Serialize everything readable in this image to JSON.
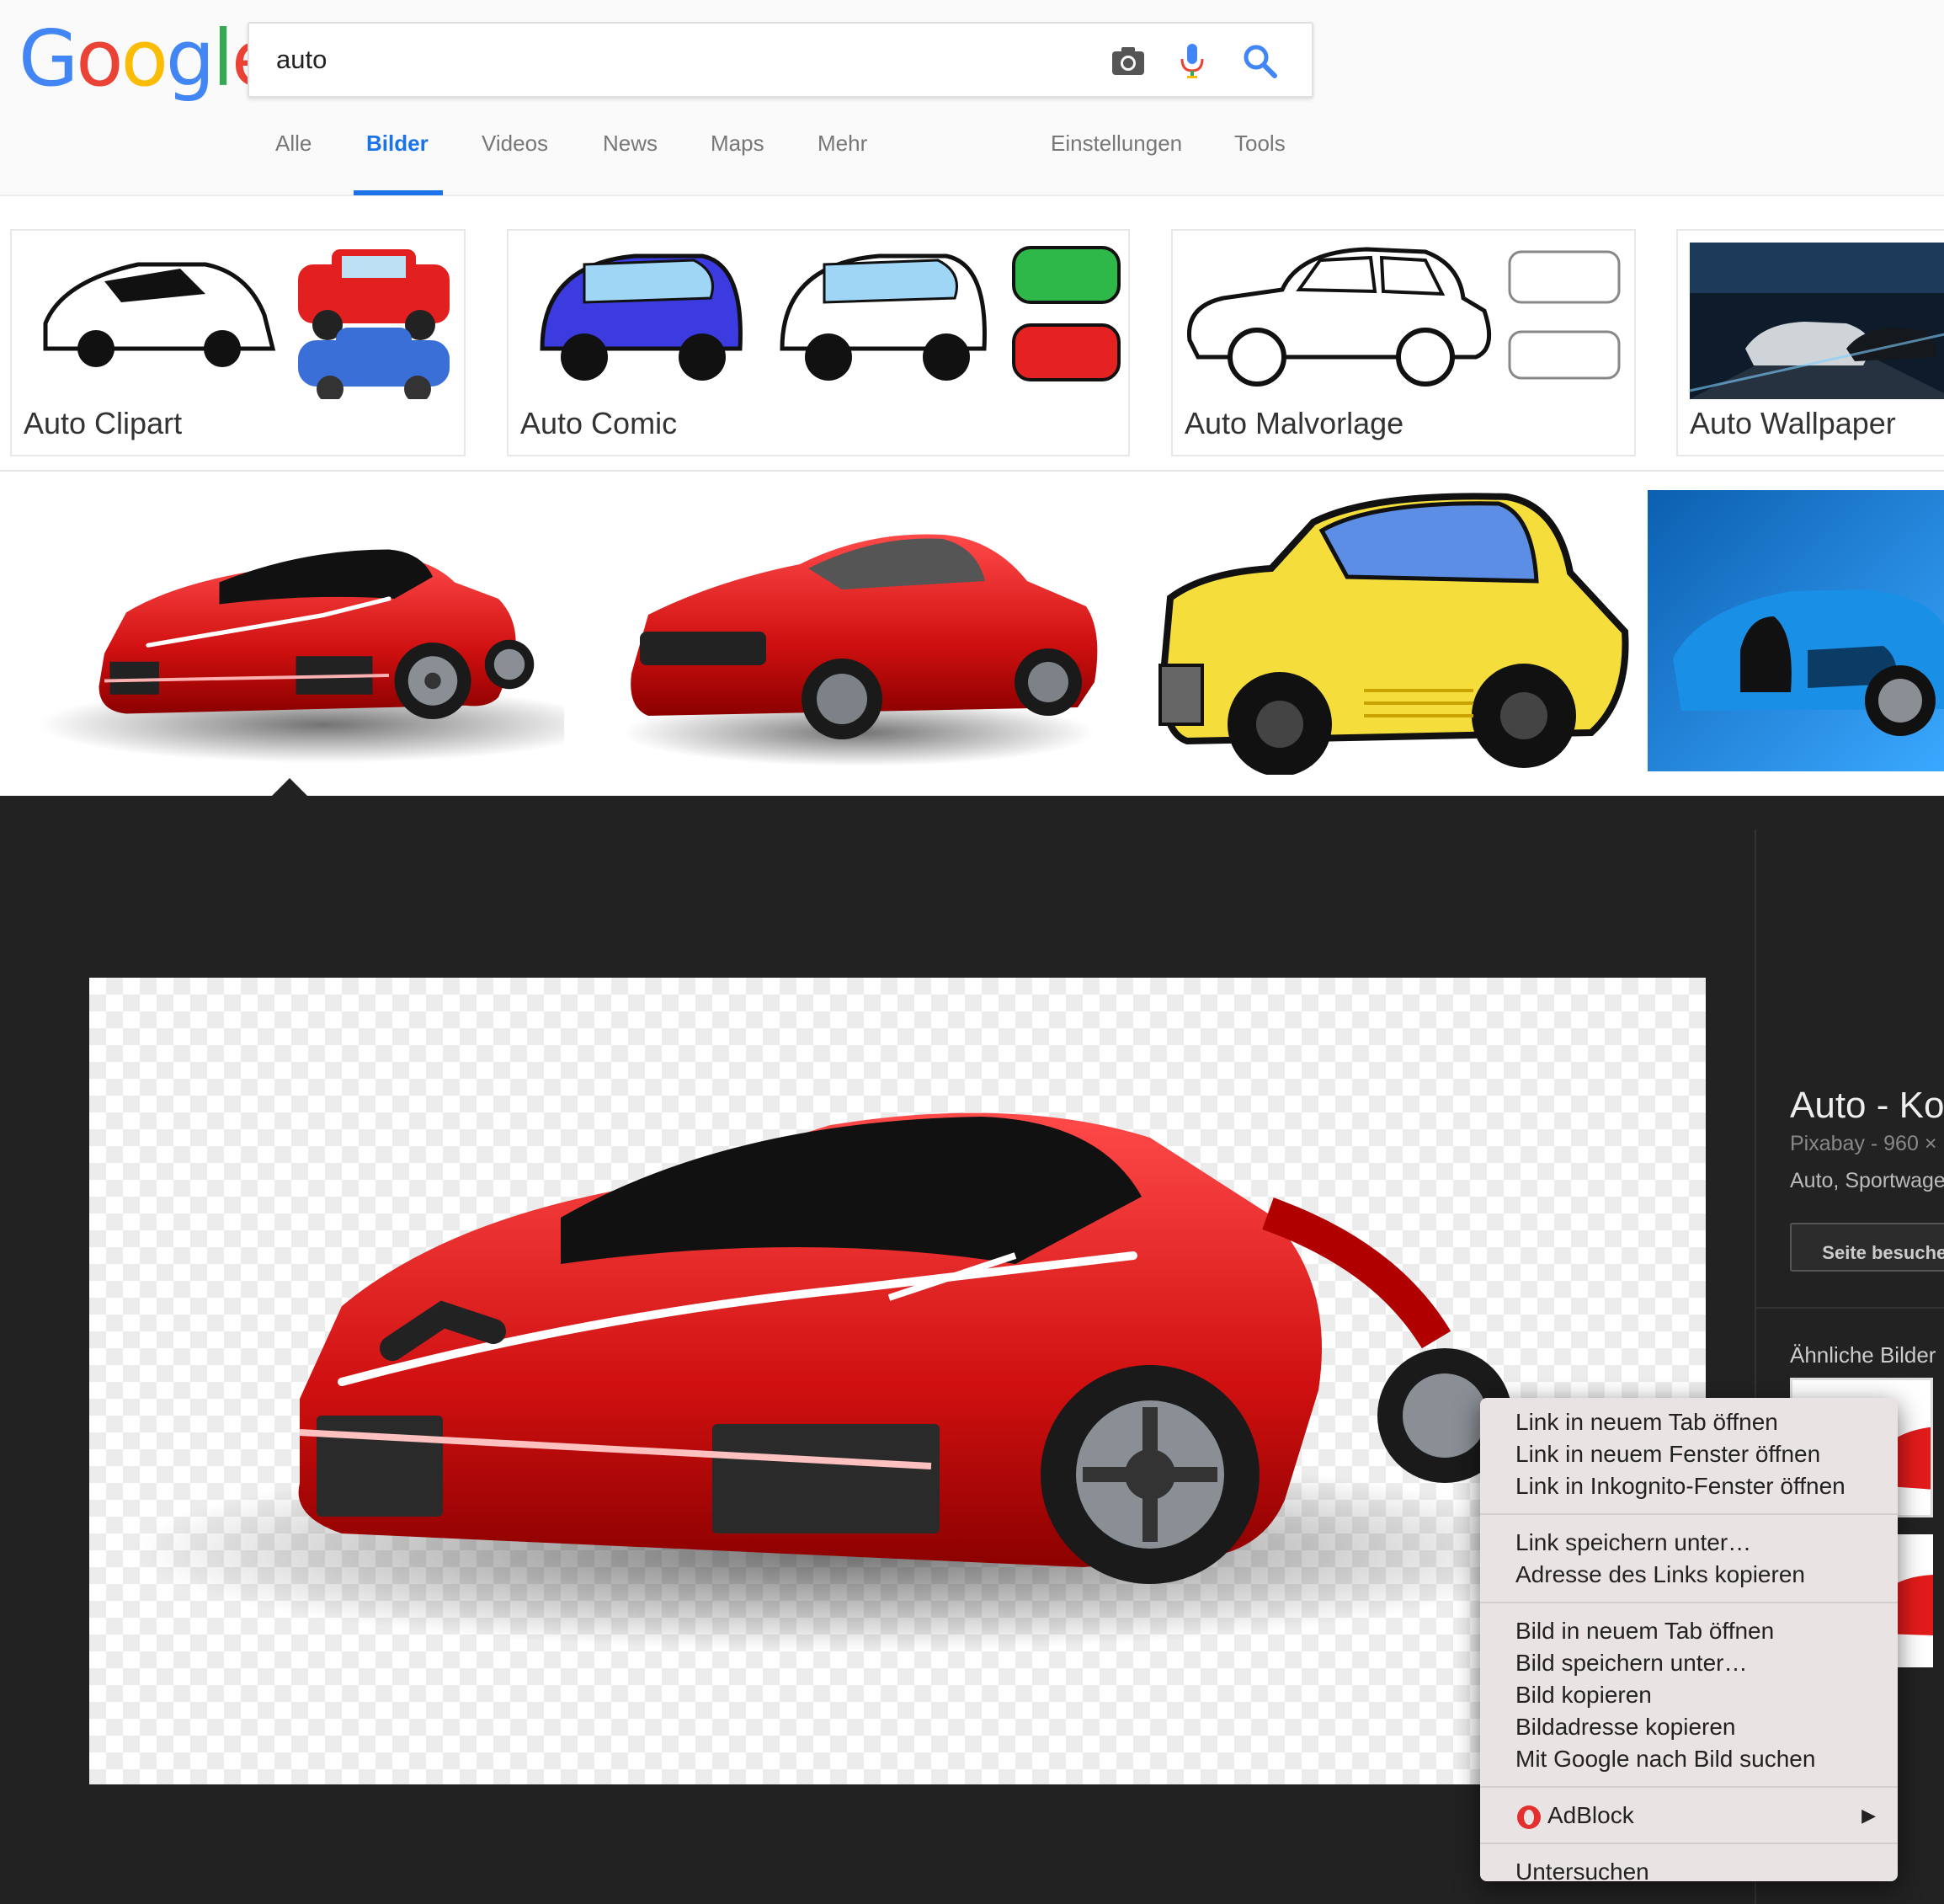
{
  "brand": {
    "logo_letters": [
      {
        "ch": "G",
        "color": "#4285f4"
      },
      {
        "ch": "o",
        "color": "#ea4335"
      },
      {
        "ch": "o",
        "color": "#fbbc05"
      },
      {
        "ch": "g",
        "color": "#4285f4"
      },
      {
        "ch": "l",
        "color": "#34a853"
      },
      {
        "ch": "e",
        "color": "#ea4335"
      }
    ],
    "accent": "#1a73e8"
  },
  "search": {
    "value": "auto",
    "icons": [
      "camera-icon",
      "microphone-icon",
      "search-icon"
    ]
  },
  "nav": {
    "tabs": [
      {
        "label": "Alle",
        "active": false
      },
      {
        "label": "Bilder",
        "active": true
      },
      {
        "label": "Videos",
        "active": false
      },
      {
        "label": "News",
        "active": false
      },
      {
        "label": "Maps",
        "active": false
      },
      {
        "label": "Mehr",
        "active": false
      }
    ],
    "settings": "Einstellungen",
    "tools": "Tools"
  },
  "related_chips": [
    {
      "label": "Auto Clipart"
    },
    {
      "label": "Auto Comic"
    },
    {
      "label": "Auto Malvorlage"
    },
    {
      "label": "Auto Wallpaper"
    }
  ],
  "results": [
    {
      "subject": "red sports car"
    },
    {
      "subject": "red coupe"
    },
    {
      "subject": "yellow cartoon car"
    },
    {
      "subject": "blue hypercar"
    }
  ],
  "preview": {
    "title": "Auto - Ko",
    "source": "Pixabay - 960 ×",
    "description": "Auto, Sportwage",
    "visit_button": "Seite besuchen",
    "similar_title": "Ähnliche Bilder"
  },
  "context_menu": {
    "groups": [
      [
        "Link in neuem Tab öffnen",
        "Link in neuem Fenster öffnen",
        "Link in Inkognito-Fenster öffnen"
      ],
      [
        "Link speichern unter…",
        "Adresse des Links kopieren"
      ],
      [
        "Bild in neuem Tab öffnen",
        "Bild speichern unter…",
        "Bild kopieren",
        "Bildadresse kopieren",
        "Mit Google nach Bild suchen"
      ]
    ],
    "adblock": "AdBlock",
    "inspect": "Untersuchen"
  }
}
